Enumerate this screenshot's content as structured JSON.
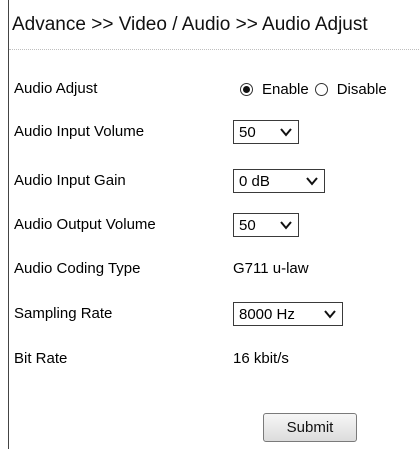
{
  "header": {
    "breadcrumb": "Advance >> Video / Audio >> Audio Adjust"
  },
  "fields": {
    "audio_adjust": {
      "label": "Audio Adjust",
      "options": [
        "Enable",
        "Disable"
      ],
      "selected": "Enable"
    },
    "input_volume": {
      "label": "Audio Input Volume",
      "value": "50"
    },
    "input_gain": {
      "label": "Audio Input Gain",
      "value": "0 dB"
    },
    "output_volume": {
      "label": "Audio Output Volume",
      "value": "50"
    },
    "coding_type": {
      "label": "Audio Coding Type",
      "value": "G711 u-law"
    },
    "sampling_rate": {
      "label": "Sampling Rate",
      "value": "8000 Hz"
    },
    "bit_rate": {
      "label": "Bit Rate",
      "value": "16 kbit/s"
    }
  },
  "actions": {
    "submit_label": "Submit"
  },
  "icons": {
    "radio_selected": "radio-selected-icon",
    "radio_unselected": "radio-unselected-icon",
    "dropdown": "chevron-down-icon"
  }
}
